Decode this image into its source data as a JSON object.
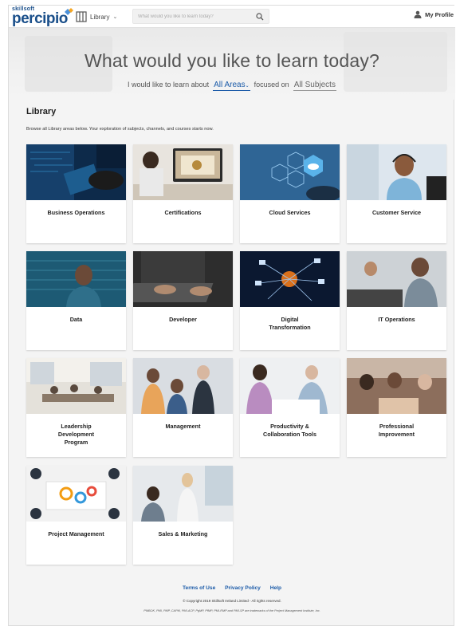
{
  "header": {
    "logo_small": "skillsoft",
    "logo_main": "percipio",
    "library_label": "Library",
    "search_placeholder": "What would you like to learn today?",
    "profile_label": "My Profile"
  },
  "hero": {
    "title": "What would you like to learn today?",
    "prefix": "I would like to learn about",
    "areas_value": "All Areas",
    "middle": "focused on",
    "subjects_value": "All Subjects"
  },
  "library": {
    "heading": "Library",
    "description": "Browse all Library areas below. Your exploration of subjects, channels, and courses starts now.",
    "cards": [
      {
        "title": "Business Operations"
      },
      {
        "title": "Certifications"
      },
      {
        "title": "Cloud Services"
      },
      {
        "title": "Customer Service"
      },
      {
        "title": "Data"
      },
      {
        "title": "Developer"
      },
      {
        "title": "Digital\nTransformation"
      },
      {
        "title": "IT Operations"
      },
      {
        "title": "Leadership\nDevelopment\nProgram"
      },
      {
        "title": "Management"
      },
      {
        "title": "Productivity &\nCollaboration Tools"
      },
      {
        "title": "Professional\nImprovement"
      },
      {
        "title": "Project Management"
      },
      {
        "title": "Sales & Marketing"
      }
    ]
  },
  "footer": {
    "terms": "Terms of Use",
    "privacy": "Privacy Policy",
    "help": "Help",
    "copyright": "© Copyright 2019 Skillsoft Ireland Limited - All rights reserved.",
    "trademark": "PMBOK, PMI, PMP, CAPM, PMI-ACP, PgMP, PfMP, PMI-RMP and PMI-SP are trademarks of the Project Management Institute, Inc."
  },
  "colors": {
    "brand": "#1a4f8a",
    "link": "#1a5aa8",
    "background": "#f4f4f4"
  },
  "icons": {
    "library": "columns-icon",
    "search": "search-icon",
    "profile": "user-icon"
  }
}
